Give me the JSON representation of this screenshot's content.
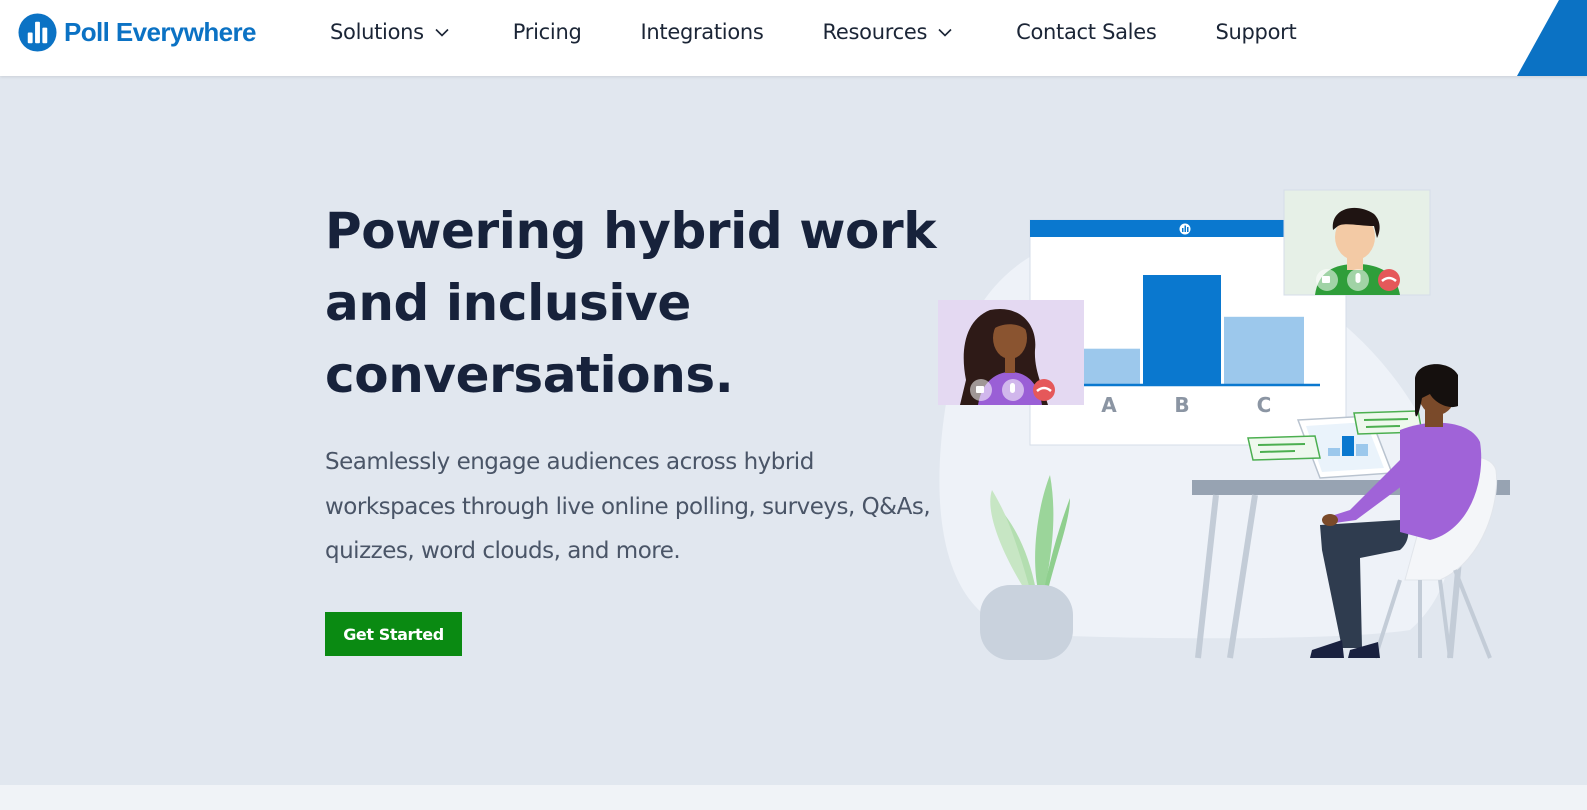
{
  "brand": {
    "name": "Poll Everywhere"
  },
  "nav": {
    "items": [
      {
        "label": "Solutions",
        "has_dropdown": true,
        "icon": "chevron-down-icon"
      },
      {
        "label": "Pricing",
        "has_dropdown": false
      },
      {
        "label": "Integrations",
        "has_dropdown": false
      },
      {
        "label": "Resources",
        "has_dropdown": true,
        "icon": "chevron-down-icon"
      },
      {
        "label": "Contact Sales",
        "has_dropdown": false
      },
      {
        "label": "Support",
        "has_dropdown": false
      }
    ]
  },
  "hero": {
    "title": "Powering hybrid work and inclusive conversations.",
    "subtitle": "Seamlessly engage audiences across hybrid workspaces through live online polling, surveys, Q&As, quizzes, word clouds, and more.",
    "cta_label": "Get Started"
  },
  "illustration": {
    "poll_chart": {
      "categories": [
        "A",
        "B",
        "C"
      ],
      "values": [
        0.33,
        1.0,
        0.62
      ]
    },
    "call_controls": [
      "video-icon",
      "microphone-icon",
      "hang-up-icon"
    ]
  },
  "colors": {
    "brand_blue": "#0b72c4",
    "cta_green": "#0a8a12",
    "hero_background": "#e1e7ef",
    "heading_text": "#17223b",
    "body_text": "#4a5567",
    "bar_primary": "#0a78cf",
    "bar_light": "#9cc8ec"
  }
}
